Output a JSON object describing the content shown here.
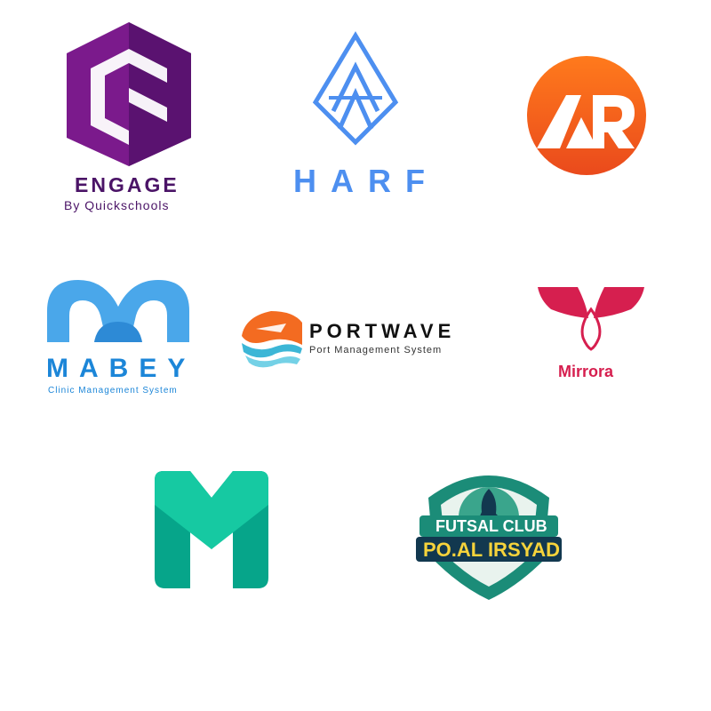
{
  "logos": {
    "engage": {
      "name": "ENGAGE",
      "tagline": "By Quickschools",
      "color": "#4b1467"
    },
    "harf": {
      "name": "HARF",
      "color": "#4d8ff0"
    },
    "ar": {
      "letters": "AR",
      "color": "#f2651c"
    },
    "mabey": {
      "name": "MABEY",
      "tagline": "Clinic Management System",
      "color": "#1c86d8"
    },
    "portwave": {
      "name": "PORTWAVE",
      "tagline": "Port Management System",
      "color": "#111111"
    },
    "mirrora": {
      "name": "Mirrora",
      "color": "#d61f4f"
    },
    "m_mark": {
      "color": "#0aa58a"
    },
    "futsal": {
      "line1": "FUTSAL CLUB",
      "line2": "PO.AL IRSYAD",
      "color": "#1b8c78"
    }
  }
}
